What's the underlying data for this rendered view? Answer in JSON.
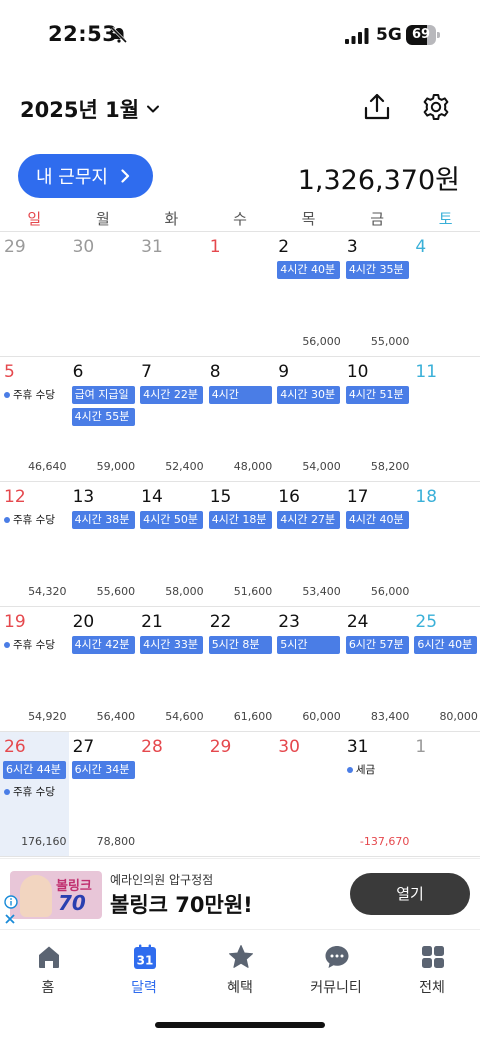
{
  "status_bar": {
    "time": "22:53",
    "network": "5G",
    "battery": "69",
    "battery_level": 0.69
  },
  "header": {
    "month_title": "2025년 1월",
    "my_work_button": "내 근무지",
    "total_amount": "1,326,370원"
  },
  "weekdays": [
    "일",
    "월",
    "화",
    "수",
    "목",
    "금",
    "토"
  ],
  "weeks": [
    [
      {
        "day": "29",
        "kind": "other",
        "pills": [],
        "dot": "",
        "amount": ""
      },
      {
        "day": "30",
        "kind": "other",
        "pills": [],
        "dot": "",
        "amount": ""
      },
      {
        "day": "31",
        "kind": "other",
        "pills": [],
        "dot": "",
        "amount": ""
      },
      {
        "day": "1",
        "kind": "red",
        "pills": [],
        "dot": "",
        "amount": ""
      },
      {
        "day": "2",
        "kind": "normal",
        "pills": [
          "4시간 40분"
        ],
        "dot": "",
        "amount": "56,000"
      },
      {
        "day": "3",
        "kind": "normal",
        "pills": [
          "4시간 35분"
        ],
        "dot": "",
        "amount": "55,000"
      },
      {
        "day": "4",
        "kind": "blue",
        "pills": [],
        "dot": "",
        "amount": ""
      }
    ],
    [
      {
        "day": "5",
        "kind": "red",
        "pills": [],
        "dot": "주휴 수당",
        "amount": "46,640"
      },
      {
        "day": "6",
        "kind": "normal",
        "pills": [
          "급여 지급일",
          "4시간 55분"
        ],
        "dot": "",
        "amount": "59,000"
      },
      {
        "day": "7",
        "kind": "normal",
        "pills": [
          "4시간 22분"
        ],
        "dot": "",
        "amount": "52,400"
      },
      {
        "day": "8",
        "kind": "normal",
        "pills": [
          "4시간"
        ],
        "dot": "",
        "amount": "48,000"
      },
      {
        "day": "9",
        "kind": "normal",
        "pills": [
          "4시간 30분"
        ],
        "dot": "",
        "amount": "54,000"
      },
      {
        "day": "10",
        "kind": "normal",
        "pills": [
          "4시간 51분"
        ],
        "dot": "",
        "amount": "58,200"
      },
      {
        "day": "11",
        "kind": "blue",
        "pills": [],
        "dot": "",
        "amount": ""
      }
    ],
    [
      {
        "day": "12",
        "kind": "red",
        "pills": [],
        "dot": "주휴 수당",
        "amount": "54,320"
      },
      {
        "day": "13",
        "kind": "normal",
        "pills": [
          "4시간 38분"
        ],
        "dot": "",
        "amount": "55,600"
      },
      {
        "day": "14",
        "kind": "normal",
        "pills": [
          "4시간 50분"
        ],
        "dot": "",
        "amount": "58,000"
      },
      {
        "day": "15",
        "kind": "normal",
        "pills": [
          "4시간 18분"
        ],
        "dot": "",
        "amount": "51,600"
      },
      {
        "day": "16",
        "kind": "normal",
        "pills": [
          "4시간 27분"
        ],
        "dot": "",
        "amount": "53,400"
      },
      {
        "day": "17",
        "kind": "normal",
        "pills": [
          "4시간 40분"
        ],
        "dot": "",
        "amount": "56,000"
      },
      {
        "day": "18",
        "kind": "blue",
        "pills": [],
        "dot": "",
        "amount": ""
      }
    ],
    [
      {
        "day": "19",
        "kind": "red",
        "pills": [],
        "dot": "주휴 수당",
        "amount": "54,920"
      },
      {
        "day": "20",
        "kind": "normal",
        "pills": [
          "4시간 42분"
        ],
        "dot": "",
        "amount": "56,400"
      },
      {
        "day": "21",
        "kind": "normal",
        "pills": [
          "4시간 33분"
        ],
        "dot": "",
        "amount": "54,600"
      },
      {
        "day": "22",
        "kind": "normal",
        "pills": [
          "5시간 8분"
        ],
        "dot": "",
        "amount": "61,600"
      },
      {
        "day": "23",
        "kind": "normal",
        "pills": [
          "5시간"
        ],
        "dot": "",
        "amount": "60,000"
      },
      {
        "day": "24",
        "kind": "normal",
        "pills": [
          "6시간 57분"
        ],
        "dot": "",
        "amount": "83,400"
      },
      {
        "day": "25",
        "kind": "blue",
        "pills": [
          "6시간 40분"
        ],
        "dot": "",
        "amount": "80,000"
      }
    ],
    [
      {
        "day": "26",
        "kind": "red",
        "today": true,
        "pills": [
          "6시간 44분"
        ],
        "dot": "주휴 수당",
        "amount": "176,160"
      },
      {
        "day": "27",
        "kind": "normal",
        "pills": [
          "6시간 34분"
        ],
        "dot": "",
        "amount": "78,800"
      },
      {
        "day": "28",
        "kind": "red",
        "pills": [],
        "dot": "",
        "amount": ""
      },
      {
        "day": "29",
        "kind": "red",
        "pills": [],
        "dot": "",
        "amount": ""
      },
      {
        "day": "30",
        "kind": "red",
        "pills": [],
        "dot": "",
        "amount": ""
      },
      {
        "day": "31",
        "kind": "normal",
        "pills": [],
        "dot": "세금",
        "amount": "-137,670",
        "negative": true
      },
      {
        "day": "1",
        "kind": "other",
        "pills": [],
        "dot": "",
        "amount": ""
      }
    ]
  ],
  "ad": {
    "image_text_1": "볼링크",
    "image_text_2": "70",
    "subtitle": "예라인의원 압구정점",
    "title": "볼링크 70만원!",
    "button": "열기"
  },
  "tabs": [
    {
      "label": "홈",
      "icon": "home-icon",
      "active": false
    },
    {
      "label": "달력",
      "icon": "calendar-icon",
      "active": true,
      "icon_text": "31"
    },
    {
      "label": "혜택",
      "icon": "star-icon",
      "active": false
    },
    {
      "label": "커뮤니티",
      "icon": "chat-icon",
      "active": false
    },
    {
      "label": "전체",
      "icon": "grid-icon",
      "active": false
    }
  ],
  "colors": {
    "accent": "#2f6cee",
    "event_pill": "#4a7de6",
    "sunday": "#e5484d",
    "saturday": "#3ab0d8"
  }
}
